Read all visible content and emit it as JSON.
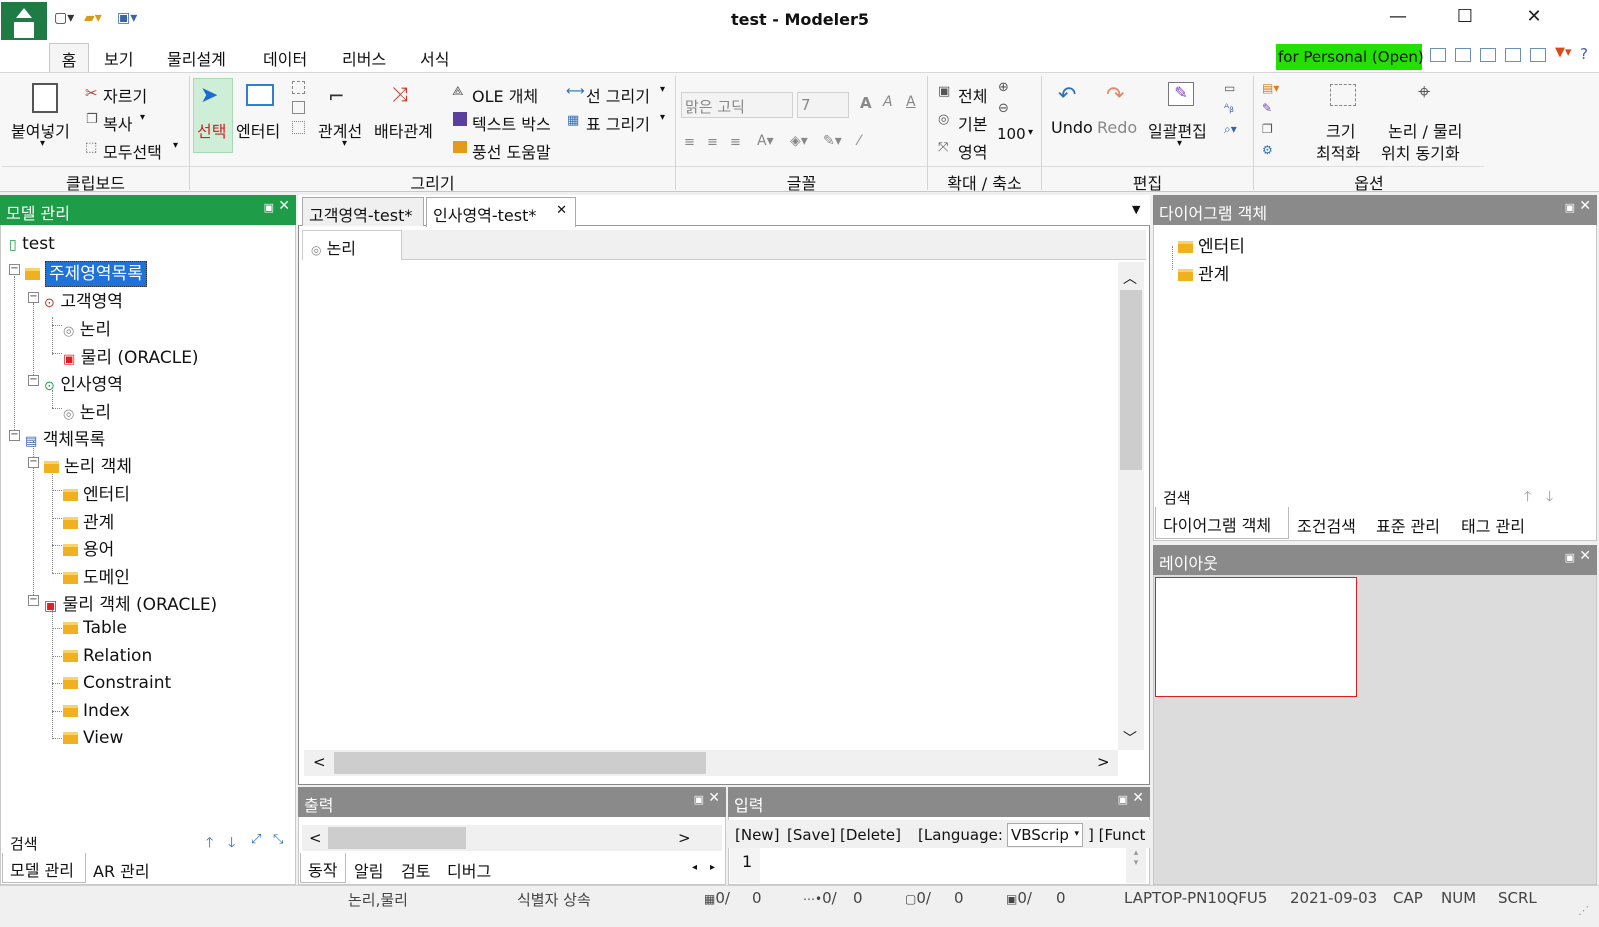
{
  "window": {
    "title": "test - Modeler5"
  },
  "menu": {
    "tabs": [
      "홈",
      "보기",
      "물리설계",
      "데이터",
      "리버스",
      "서식"
    ],
    "badge": "for Personal (Open)",
    "help": "?"
  },
  "ribbon": {
    "clipboard": {
      "label": "클립보드",
      "paste": "붙여넣기",
      "cut": "자르기",
      "copy": "복사",
      "select_all": "모두선택"
    },
    "draw": {
      "label": "그리기",
      "select": "선택",
      "entity": "엔터티",
      "relation_line": "관계선",
      "exclusive": "배타관계",
      "ole": "OLE 개체",
      "textbox": "텍스트 박스",
      "balloon": "풍선 도움말",
      "line_draw": "선 그리기",
      "table_draw": "표 그리기"
    },
    "font": {
      "label": "글꼴",
      "font_name": "맑은 고딕",
      "font_size": "7"
    },
    "zoom": {
      "label": "확대 / 축소",
      "all": "전체",
      "default": "기본",
      "area": "영역",
      "value": "100"
    },
    "edit": {
      "label": "편집",
      "undo": "Undo",
      "redo": "Redo",
      "bulk_edit": "일괄편집"
    },
    "options": {
      "label": "옵션",
      "size1": "크기",
      "size2": "최적화",
      "sync1": "논리 / 물리",
      "sync2": "위치 동기화"
    }
  },
  "model_panel": {
    "title": "모델 관리",
    "search_label": "검색",
    "tabs": [
      "모델 관리",
      "AR 관리"
    ],
    "tree": {
      "root": "test",
      "subject_list": "주제영역목록",
      "customer": "고객영역",
      "logical": "논리",
      "physical_oracle": "물리 (ORACLE)",
      "hr": "인사영역",
      "object_list": "객체목록",
      "logical_objects": "논리 객체",
      "entity": "엔터티",
      "relation": "관계",
      "term": "용어",
      "domain": "도메인",
      "physical_objects": "물리 객체 (ORACLE)",
      "phys_items": [
        "Table",
        "Relation",
        "Constraint",
        "Index",
        "View"
      ]
    }
  },
  "doc_tabs": [
    "고객영역-test*",
    "인사영역-test*"
  ],
  "canvas": {
    "sub_tab": "논리"
  },
  "output_panel": {
    "title": "출력",
    "tabs": [
      "동작",
      "알림",
      "검토",
      "디버그"
    ]
  },
  "input_panel": {
    "title": "입력",
    "new": "[New]",
    "save": "[Save]",
    "delete": "[Delete]",
    "language_label": "[Language:",
    "language_value": "VBScrip",
    "func": "] [Funct",
    "line_no": "1"
  },
  "diagram_panel": {
    "title": "다이어그램 객체",
    "items": [
      "엔터티",
      "관계"
    ],
    "search_label": "검색",
    "tabs": [
      "다이어그램 객체",
      "조건검색",
      "표준 관리",
      "태그 관리"
    ]
  },
  "layout_panel": {
    "title": "레이아웃"
  },
  "status": {
    "mode": "논리,물리",
    "inherit": "식별자 상속",
    "c1a": "0/",
    "c1b": "0",
    "c2a": "0/",
    "c2b": "0",
    "c3a": "0/",
    "c3b": "0",
    "c4a": "0/",
    "c4b": "0",
    "host": "LAPTOP-PN10QFU5",
    "date": "2021-09-03",
    "cap": "CAP",
    "num": "NUM",
    "scrl": "SCRL"
  },
  "colors": {
    "accent": "#1f9c47",
    "badge": "#22e000",
    "selection": "#1e72d8"
  }
}
